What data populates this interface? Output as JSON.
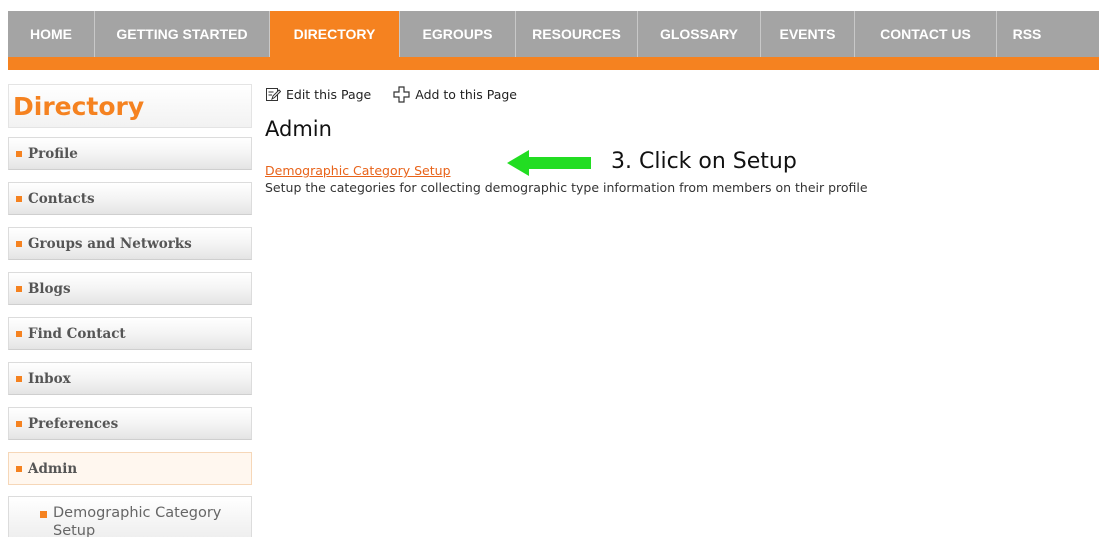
{
  "topnav": {
    "items": [
      {
        "label": "HOME",
        "active": false
      },
      {
        "label": "GETTING STARTED",
        "active": false
      },
      {
        "label": "DIRECTORY",
        "active": true
      },
      {
        "label": "EGROUPS",
        "active": false
      },
      {
        "label": "RESOURCES",
        "active": false
      },
      {
        "label": "GLOSSARY",
        "active": false
      },
      {
        "label": "EVENTS",
        "active": false
      },
      {
        "label": "CONTACT US",
        "active": false
      },
      {
        "label": "RSS",
        "active": false
      }
    ]
  },
  "sidebar": {
    "title": "Directory",
    "items": [
      {
        "label": "Profile"
      },
      {
        "label": "Contacts"
      },
      {
        "label": "Groups and Networks"
      },
      {
        "label": "Blogs"
      },
      {
        "label": "Find Contact"
      },
      {
        "label": "Inbox"
      },
      {
        "label": "Preferences"
      },
      {
        "label": "Admin",
        "active": true
      }
    ],
    "subitem": {
      "label": "Demographic Category Setup"
    }
  },
  "toolbar": {
    "edit_label": "Edit this Page",
    "add_label": "Add to this Page"
  },
  "main": {
    "title": "Admin",
    "link_label": "Demographic Category Setup",
    "description": "Setup the categories for collecting demographic type information from members on their profile"
  },
  "annotation": {
    "text": "3.  Click on Setup",
    "arrow_color": "#22dd22"
  },
  "colors": {
    "accent": "#f58220",
    "nav_bg": "#a4a4a4",
    "link": "#e8631a"
  }
}
